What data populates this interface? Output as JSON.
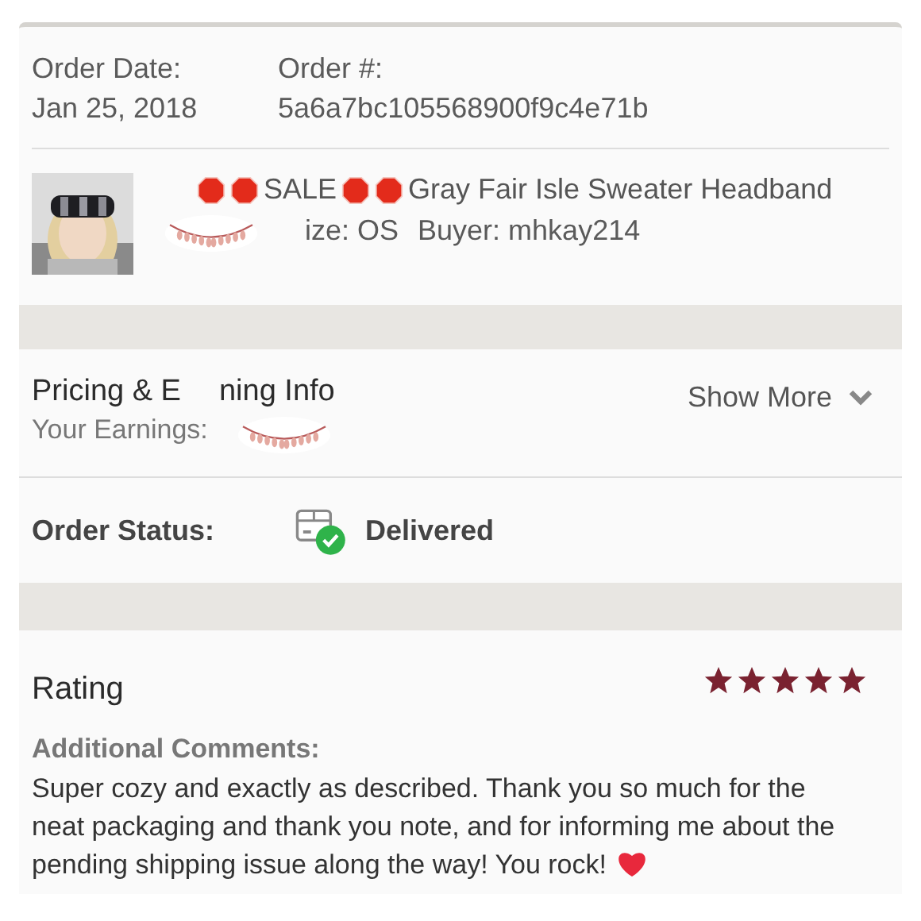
{
  "order": {
    "date_label": "Order Date:",
    "date": "Jan 25, 2018",
    "number_label": "Order #:",
    "number": "5a6a7bc105568900f9c4e71b"
  },
  "item": {
    "title_parts": [
      {
        "kind": "emoji"
      },
      {
        "kind": "emoji"
      },
      {
        "kind": "text",
        "text": "SALE"
      },
      {
        "kind": "emoji"
      },
      {
        "kind": "emoji"
      },
      {
        "kind": "text",
        "text": "Gray Fair Isle Sweater Headband"
      }
    ],
    "size": "ize: OS",
    "buyer": "Buyer: mhkay214"
  },
  "pricing": {
    "title_start": "Pricing & E",
    "title_end": "ning Info",
    "earnings_label": "Your Earnings:",
    "toggle": "Show More"
  },
  "status": {
    "label": "Order Status:",
    "value": "Delivered"
  },
  "rating": {
    "title": "Rating",
    "stars": 5,
    "comments_label": "Additional Comments:",
    "comment": "Super cozy and exactly as described. Thank you so much for the neat packaging and thank you note, and for informing me about the pending shipping issue along the way! You rock!"
  }
}
